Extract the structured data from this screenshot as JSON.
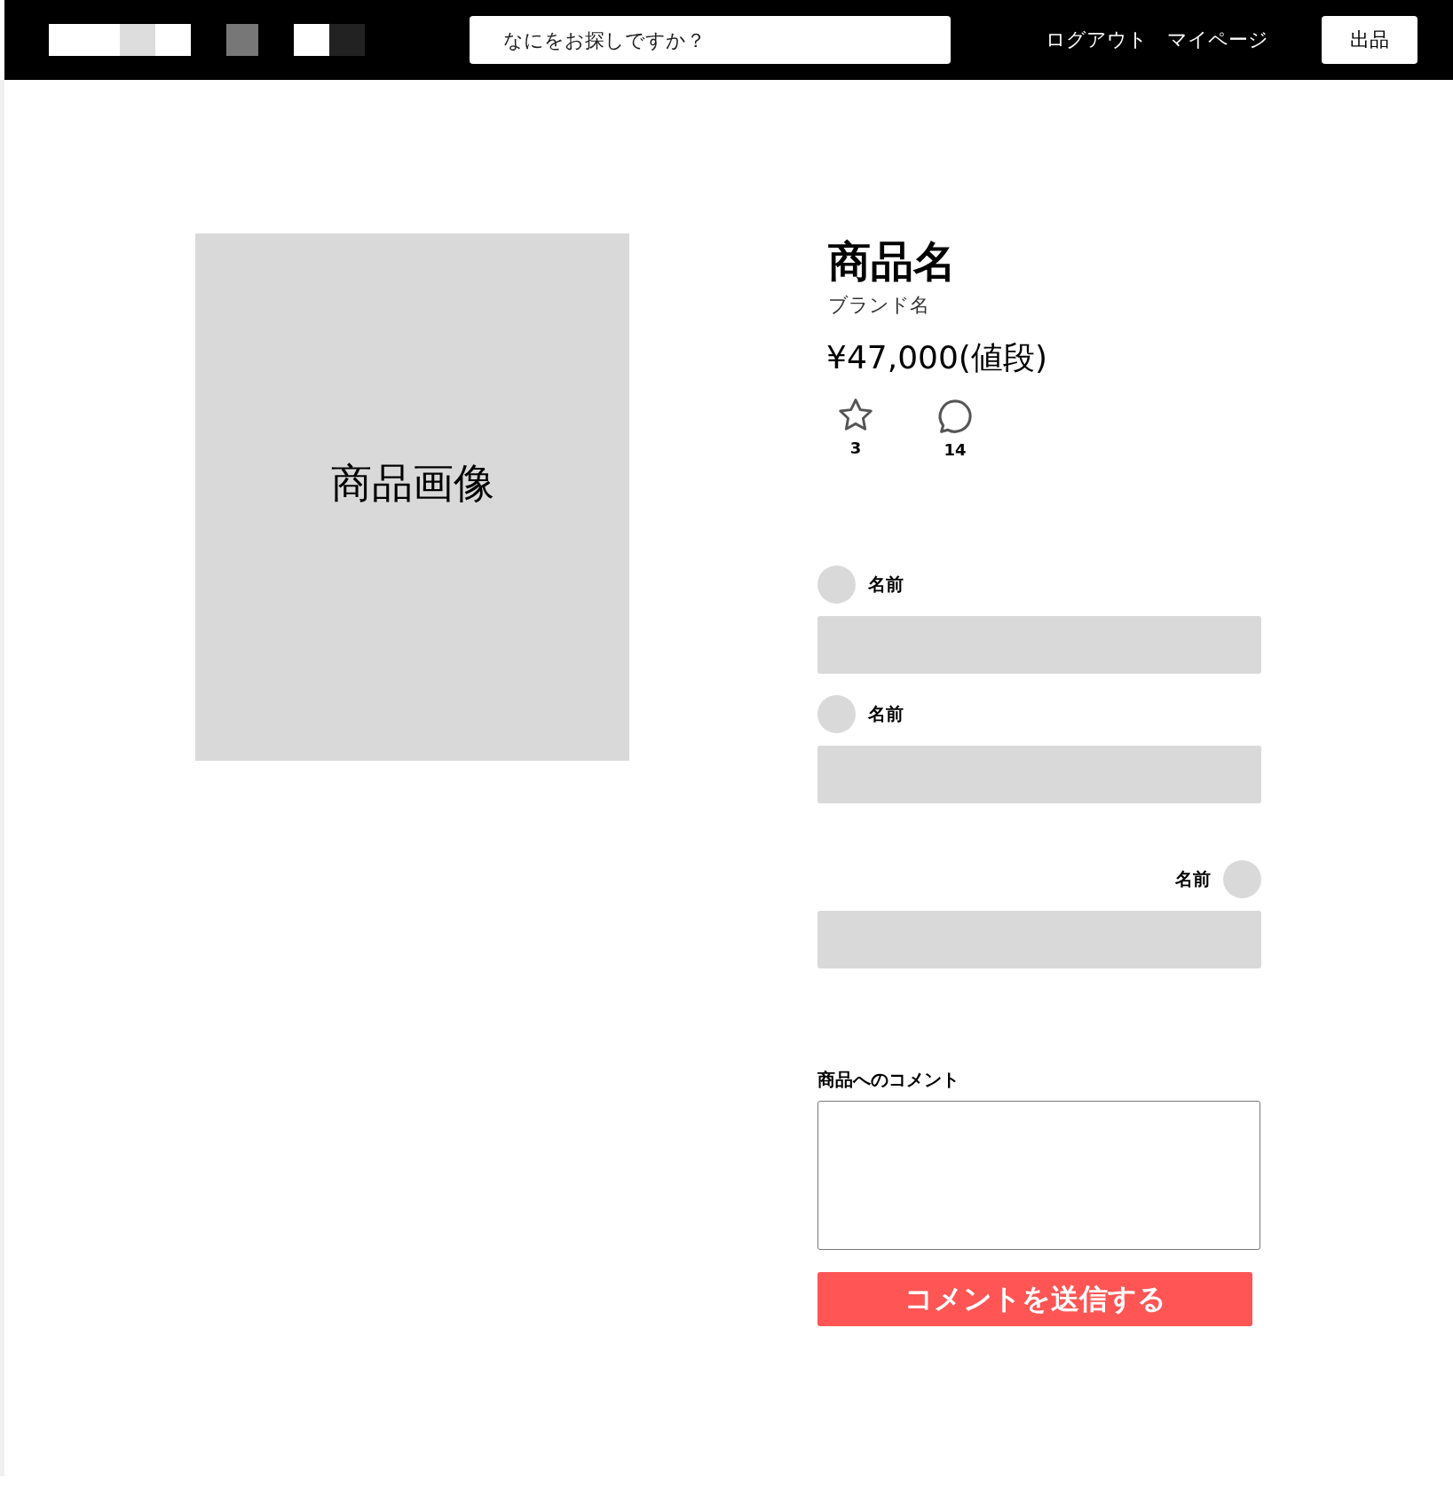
{
  "header": {
    "search": {
      "placeholder": "なにをお探しですか？"
    },
    "links": [
      "ログアウト",
      "マイページ"
    ],
    "sell_button": "出品"
  },
  "product": {
    "image_label": "商品画像",
    "name": "商品名",
    "brand": "ブランド名",
    "price": "¥47,000(値段)",
    "likes": "3",
    "comments_count": "14"
  },
  "comments": [
    {
      "name": "名前",
      "kind": "other"
    },
    {
      "name": "名前",
      "kind": "other"
    },
    {
      "name": "名前",
      "kind": "own"
    }
  ],
  "comment_form": {
    "label": "商品へのコメント",
    "submit": "コメントを送信する"
  }
}
